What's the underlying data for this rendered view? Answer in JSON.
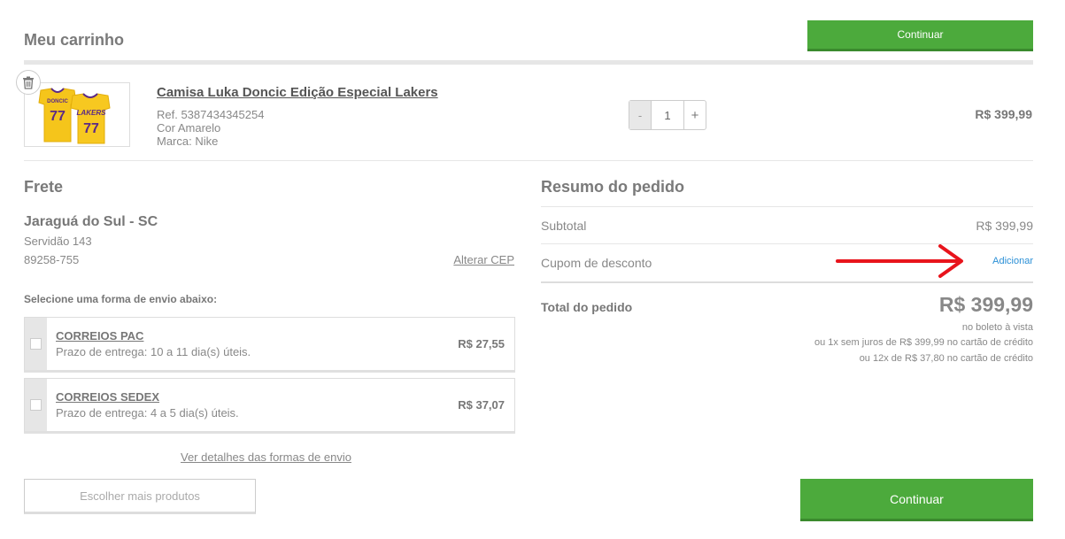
{
  "header": {
    "title": "Meu carrinho",
    "continue_label": "Continuar"
  },
  "item": {
    "name": "Camisa Luka Doncic Edição Especial Lakers",
    "ref": "Ref. 5387434345254",
    "color": "Cor Amarelo",
    "brand": "Marca: Nike",
    "quantity": "1",
    "minus": "-",
    "plus": "+",
    "price": "R$ 399,99",
    "jersey_name": "DONCIC",
    "jersey_number": "77",
    "jersey_team": "LAKERS"
  },
  "frete": {
    "title": "Frete",
    "city": "Jaraguá do Sul - SC",
    "street": "Servidão 143",
    "cep": "89258-755",
    "change_cep": "Alterar CEP",
    "select_label": "Selecione uma forma de envio abaixo:",
    "options": [
      {
        "name": "CORREIOS PAC",
        "deadline": "Prazo de entrega: 10 a 11 dia(s) úteis.",
        "price": "R$ 27,55"
      },
      {
        "name": "CORREIOS SEDEX",
        "deadline": "Prazo de entrega: 4 a 5 dia(s) úteis.",
        "price": "R$ 37,07"
      }
    ],
    "details_link": "Ver detalhes das formas de envio",
    "more_products": "Escolher mais produtos"
  },
  "resumo": {
    "title": "Resumo do pedido",
    "subtotal_label": "Subtotal",
    "subtotal_value": "R$ 399,99",
    "coupon_label": "Cupom de desconto",
    "coupon_add": "Adicionar",
    "total_label": "Total do pedido",
    "total_value": "R$ 399,99",
    "payment_lines": [
      "no boleto à vista",
      "ou 1x sem juros de R$ 399,99 no cartão de crédito",
      "ou 12x de R$ 37,80 no cartão de crédito"
    ],
    "continue_label": "Continuar"
  },
  "colors": {
    "accent_green": "#4caa3c",
    "link_blue": "#2a8fd6",
    "arrow_red": "#e8141c"
  }
}
